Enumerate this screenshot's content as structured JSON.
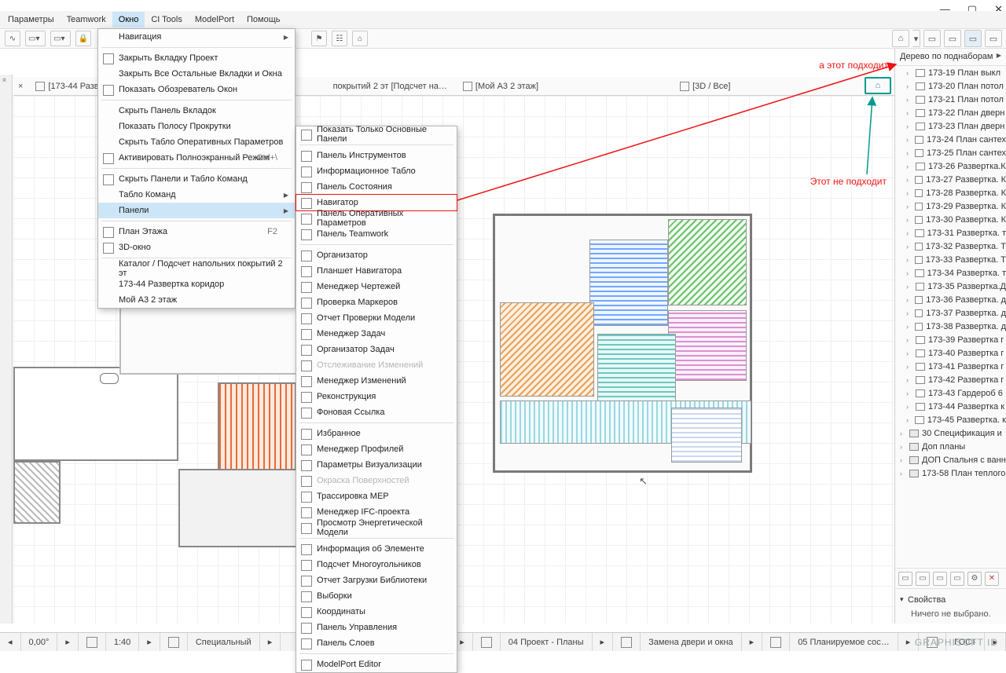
{
  "window_controls": {
    "min": "—",
    "max": "▢",
    "close": "✕"
  },
  "menubar": [
    "Параметры",
    "Teamwork",
    "Окно",
    "CI Tools",
    "ModelPort",
    "Помощь"
  ],
  "menubar_open_index": 2,
  "toolbar_right_icons": [
    "⌂",
    "▭",
    "▭",
    "▭",
    "▭"
  ],
  "tabs": {
    "close": "×",
    "items": [
      "[173-44 Разверт…",
      "покрытий 2 эт [Подсчет на…",
      "[Мой А3 2 этаж]",
      "[3D / Все]"
    ],
    "far_icon": "⌂"
  },
  "menu_okno": {
    "nav_header": "Навигация",
    "items": [
      {
        "t": "Закрыть Вкладку Проект",
        "icon": true
      },
      {
        "t": "Закрыть Все Остальные Вкладки и Окна"
      },
      {
        "t": "Показать Обозреватель Окон",
        "icon": true,
        "sep": true
      },
      {
        "t": "Скрыть Панель Вкладок"
      },
      {
        "t": "Показать Полосу Прокрутки"
      },
      {
        "t": "Скрыть Табло Оперативных Параметров"
      },
      {
        "t": "Активировать Полноэкранный Режим",
        "icon": true,
        "hint": "Ctrl+\\",
        "sep": true
      },
      {
        "t": "Скрыть Панели и Табло Команд",
        "icon": true
      },
      {
        "t": "Табло Команд",
        "sub": true
      },
      {
        "t": "Панели",
        "sub": true,
        "sel": true,
        "sep": true
      },
      {
        "t": "План Этажа",
        "icon": true,
        "hint": "F2"
      },
      {
        "t": "3D-окно",
        "icon": true,
        "sep": true
      },
      {
        "t": "Каталог /  Подсчет напольних покрытий 2 эт"
      },
      {
        "t": "173-44 Развертка коридор"
      },
      {
        "t": "Мой А3 2 этаж"
      }
    ]
  },
  "submenu_panels": [
    {
      "t": "Показать Только Основные Панели",
      "sep": true
    },
    {
      "t": "Панель Инструментов"
    },
    {
      "t": "Информационное Табло"
    },
    {
      "t": "Панель Состояния"
    },
    {
      "t": "Навигатор",
      "boxed": true
    },
    {
      "t": "Панель Оперативных Параметров"
    },
    {
      "t": "Панель Teamwork",
      "sep": true
    },
    {
      "t": "Организатор"
    },
    {
      "t": "Планшет Навигатора"
    },
    {
      "t": "Менеджер Чертежей"
    },
    {
      "t": "Проверка Маркеров"
    },
    {
      "t": "Отчет Проверки Модели"
    },
    {
      "t": "Менеджер Задач"
    },
    {
      "t": "Организатор Задач"
    },
    {
      "t": "Отслеживание Изменений",
      "disabled": true
    },
    {
      "t": "Менеджер Изменений"
    },
    {
      "t": "Реконструкция"
    },
    {
      "t": "Фоновая Ссылка",
      "sep": true
    },
    {
      "t": "Избранное"
    },
    {
      "t": "Менеджер Профилей"
    },
    {
      "t": "Параметры Визуализации"
    },
    {
      "t": "Окраска Поверхностей",
      "disabled": true
    },
    {
      "t": "Трассировка MEP"
    },
    {
      "t": "Менеджер IFC-проекта"
    },
    {
      "t": "Просмотр Энергетической Модели",
      "sep": true
    },
    {
      "t": "Информация об Элементе"
    },
    {
      "t": "Подсчет Многоугольников"
    },
    {
      "t": "Отчет Загрузки Библиотеки"
    },
    {
      "t": "Выборки"
    },
    {
      "t": "Координаты"
    },
    {
      "t": "Панель Управления"
    },
    {
      "t": "Панель Слоев",
      "sep": true
    },
    {
      "t": "ModelPort Editor"
    }
  ],
  "annotations": {
    "ok": "а этот подходит",
    "no": "Этот не подходит"
  },
  "nav": {
    "header": "Дерево по поднаборам",
    "items": [
      "173-19 План выкл",
      "173-20 План потол",
      "173-21 План потол",
      "173-22 План дверн",
      "173-23 План дверн",
      "173-24 План сантех",
      "173-25 План сантех",
      "173-26 Развертка.К",
      "173-27 Развертка. К",
      "173-28 Развертка. К",
      "173-29 Развертка. К",
      "173-30 Развертка. К",
      "173-31 Развертка. т",
      "173-32 Развертка. Т",
      "173-33 Развертка. Т",
      "173-34 Развертка. т",
      "173-35 Развертка.Д",
      "173-36 Развертка. д",
      "173-37 Развертка. д",
      "173-38 Развертка. д",
      "173-39 Развертка г",
      "173-40 Развертка г",
      "173-41 Развертка г",
      "173-42 Развертка г",
      "173-43 Гардероб 6",
      "173-44 Развертка к",
      "173-45 Развертка. к"
    ],
    "folders": [
      "30 Спецификация и",
      "Доп планы",
      "ДОП Спальня с ванн",
      "173-58 План теплого"
    ],
    "props_title": "Свойства",
    "props_empty": "Ничего не выбрано."
  },
  "status": {
    "angle": "0,00°",
    "scale": "1:40",
    "layerset": "Специальный",
    "view1": "04 Проект - Планы",
    "view2": "Замена двери и окна",
    "view3": "05 Планируемое сос…",
    "std": "ГОСТ",
    "brand": "GRAPHISOFT ID"
  }
}
